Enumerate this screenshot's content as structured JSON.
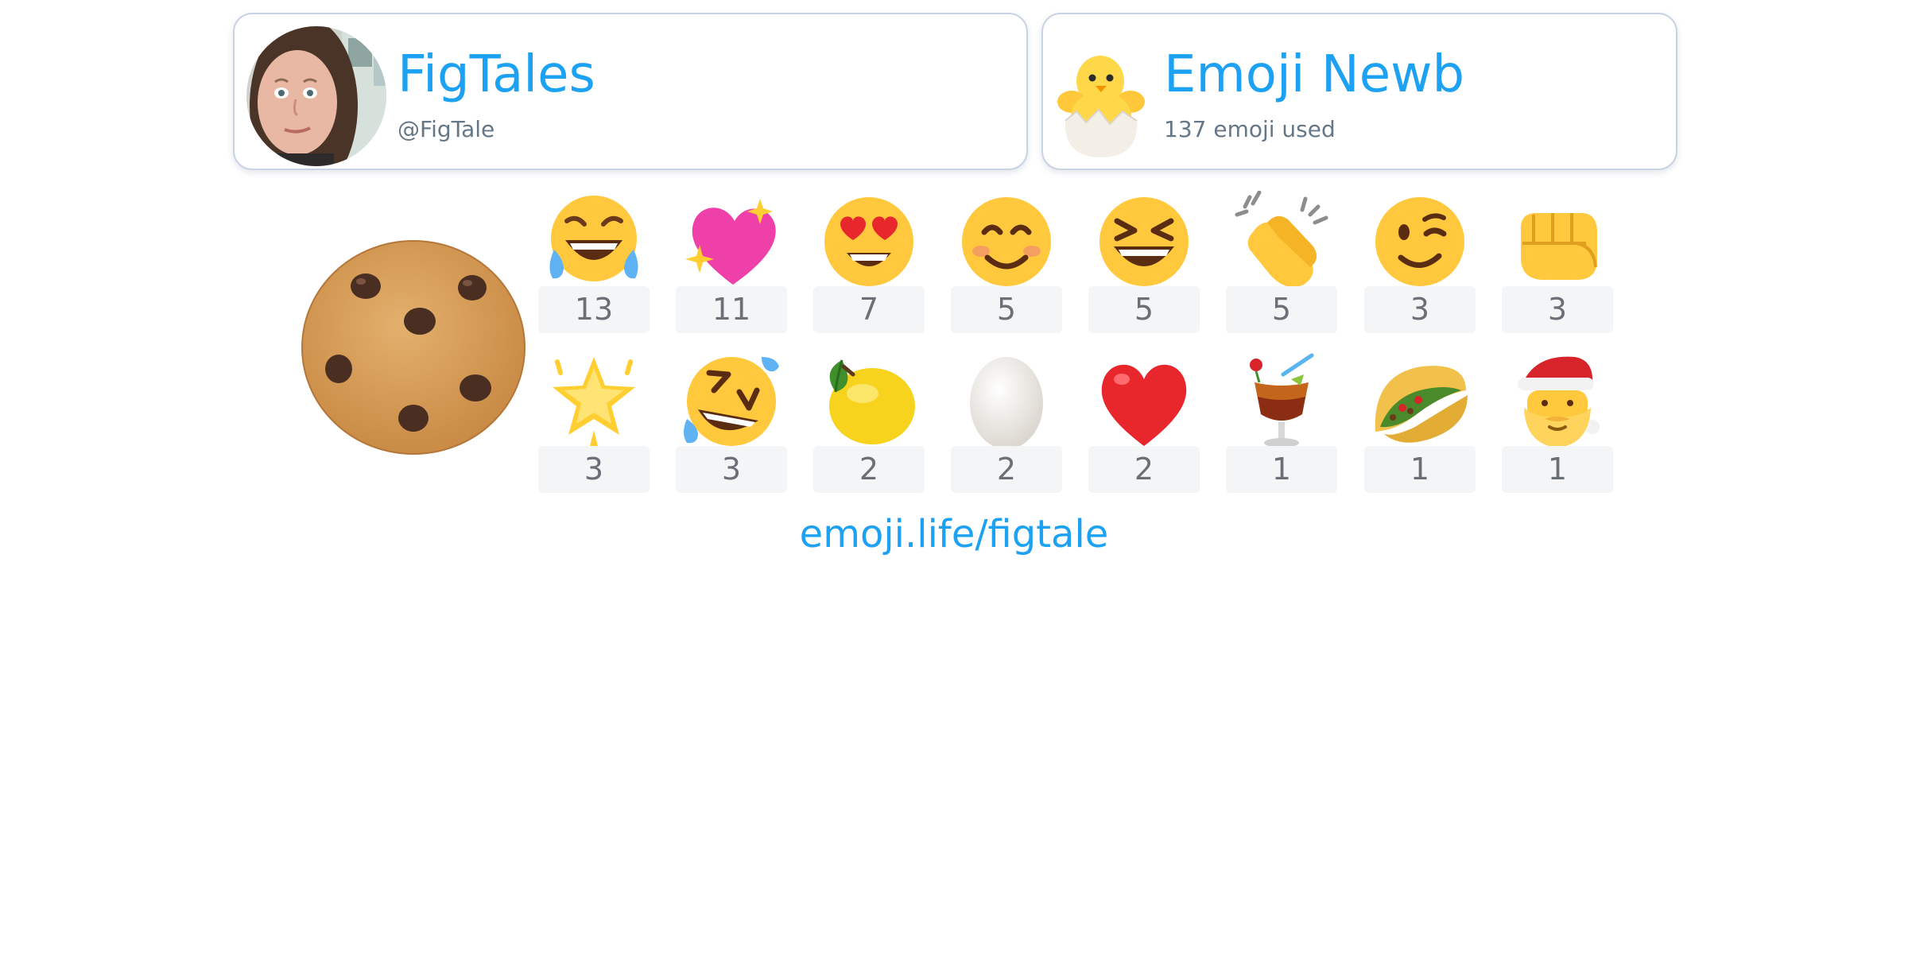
{
  "profile": {
    "name": "FigTales",
    "handle": "@FigTale"
  },
  "rank": {
    "title": "Emoji Newb",
    "emoji_count_text": "137 emoji used",
    "badge_icon": "hatching-chick-icon"
  },
  "featured_emoji": "cookie-icon",
  "emoji_stats": [
    {
      "icon": "face-with-tears-of-joy-icon",
      "count": "13"
    },
    {
      "icon": "sparkling-heart-icon",
      "count": "11"
    },
    {
      "icon": "heart-eyes-face-icon",
      "count": "7"
    },
    {
      "icon": "smiling-face-icon",
      "count": "5"
    },
    {
      "icon": "grinning-squinting-face-icon",
      "count": "5"
    },
    {
      "icon": "clapping-hands-icon",
      "count": "5"
    },
    {
      "icon": "winking-face-icon",
      "count": "3"
    },
    {
      "icon": "oncoming-fist-icon",
      "count": "3"
    },
    {
      "icon": "glowing-star-icon",
      "count": "3"
    },
    {
      "icon": "rolling-on-floor-laughing-icon",
      "count": "3"
    },
    {
      "icon": "lemon-icon",
      "count": "2"
    },
    {
      "icon": "egg-icon",
      "count": "2"
    },
    {
      "icon": "red-heart-icon",
      "count": "2"
    },
    {
      "icon": "tropical-drink-icon",
      "count": "1"
    },
    {
      "icon": "taco-icon",
      "count": "1"
    },
    {
      "icon": "santa-claus-icon",
      "count": "1"
    }
  ],
  "footer": {
    "link": "emoji.life/figtale"
  }
}
